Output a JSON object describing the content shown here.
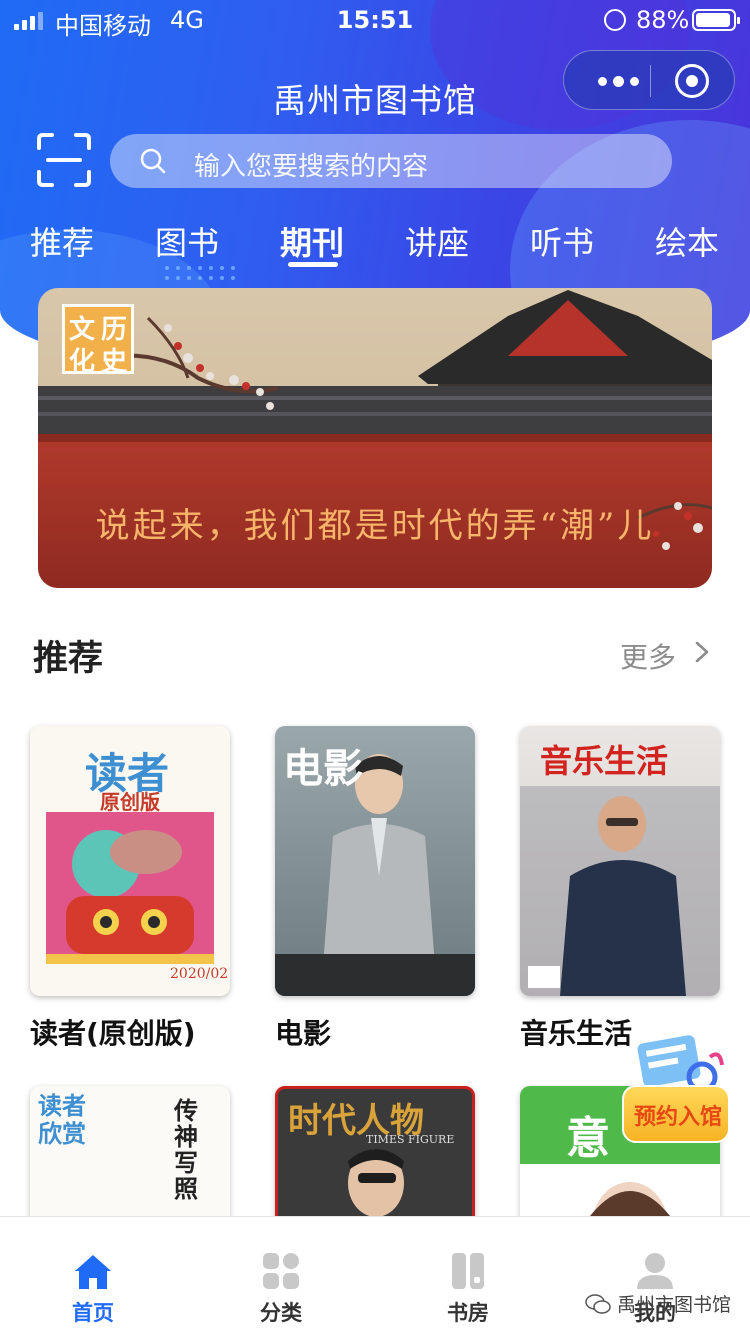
{
  "status_bar": {
    "carrier": "中国移动",
    "network": "4G",
    "time": "15:51",
    "battery": "88%"
  },
  "header": {
    "title": "禹州市图书馆"
  },
  "search": {
    "placeholder": "输入您要搜索的内容"
  },
  "tabs": [
    {
      "label": "推荐"
    },
    {
      "label": "图书"
    },
    {
      "label": "期刊",
      "active": true
    },
    {
      "label": "讲座"
    },
    {
      "label": "听书"
    },
    {
      "label": "绘本"
    }
  ],
  "banner": {
    "badge_chars": [
      "文",
      "历",
      "化",
      "史"
    ],
    "slogan": "说起来，我们都是时代的弄“潮”儿"
  },
  "section": {
    "title": "推荐",
    "more": "更多"
  },
  "books": [
    {
      "title": "读者(原创版)",
      "cover_title": "读者",
      "cover_sub": "原创版",
      "cover_date": "2020/02"
    },
    {
      "title": "电影",
      "cover_title": "电影"
    },
    {
      "title": "音乐生活",
      "cover_title": "音乐生活"
    },
    {
      "title": "",
      "cover_title": "读者欣赏",
      "cover_sub": "传神写照"
    },
    {
      "title": "",
      "cover_title": "时代人物",
      "cover_sub": "TIMES FIGURE"
    },
    {
      "title": "",
      "cover_title": "意"
    }
  ],
  "floating": {
    "reserve_label": "预约入馆"
  },
  "tabbar": [
    {
      "label": "首页",
      "icon": "home-icon",
      "active": true
    },
    {
      "label": "分类",
      "icon": "category-icon"
    },
    {
      "label": "书房",
      "icon": "bookroom-icon"
    },
    {
      "label": "我的",
      "icon": "profile-icon"
    }
  ],
  "watermark": "禹州市图书馆",
  "colors": {
    "primary": "#1f6bf5",
    "reserve": "#f7b325"
  }
}
